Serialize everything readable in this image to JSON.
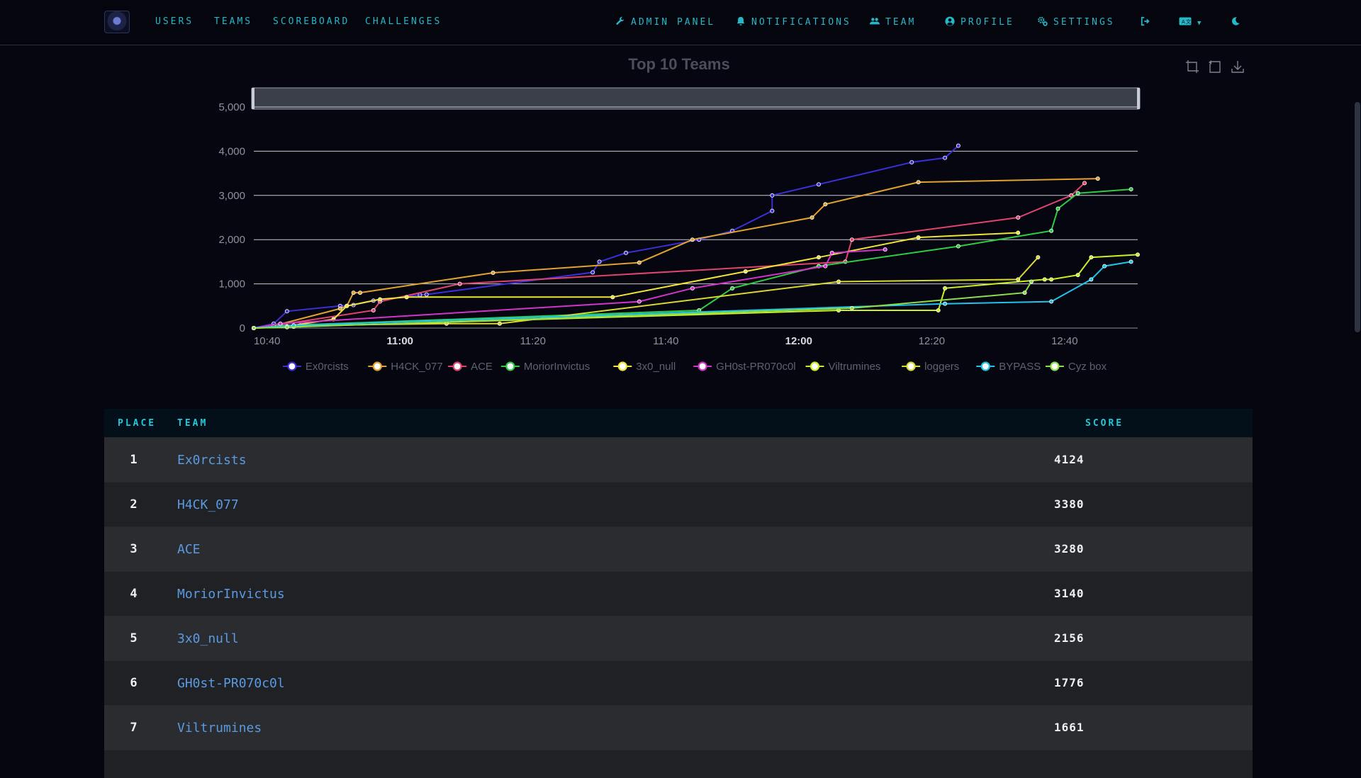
{
  "nav": {
    "left": [
      {
        "label": "USERS"
      },
      {
        "label": "TEAMS"
      },
      {
        "label": "SCOREBOARD"
      },
      {
        "label": "CHALLENGES"
      }
    ],
    "right": [
      {
        "label": "ADMIN PANEL",
        "icon": "wrench-icon"
      },
      {
        "label": "NOTIFICATIONS",
        "icon": "bell-icon"
      },
      {
        "label": "TEAM",
        "icon": "users-icon"
      },
      {
        "label": "PROFILE",
        "icon": "user-circle-icon"
      },
      {
        "label": "SETTINGS",
        "icon": "cogs-icon"
      }
    ],
    "logout_icon": "logout-icon",
    "language_icon": "language-icon",
    "theme_icon": "moon-icon"
  },
  "chart_data": {
    "type": "line",
    "title": "Top 10 Teams",
    "x_ticks": [
      "10:40",
      "11:00",
      "11:20",
      "11:40",
      "12:00",
      "12:20",
      "12:40"
    ],
    "x_major_ticks": [
      "11:00",
      "12:00"
    ],
    "y_ticks": [
      0,
      1000,
      2000,
      3000,
      4000,
      5000
    ],
    "y_tick_labels": [
      "0",
      "1,000",
      "2,000",
      "3,000",
      "4,000",
      "5,000"
    ],
    "xlim": [
      "10:38",
      "12:51"
    ],
    "ylim": [
      0,
      5000
    ],
    "grid": true,
    "legend_position": "bottom",
    "series": [
      {
        "name": "Ex0rcists",
        "color": "#3b30d8",
        "points": [
          [
            "10:38",
            0
          ],
          [
            "10:41",
            100
          ],
          [
            "10:43",
            380
          ],
          [
            "10:51",
            500
          ],
          [
            "10:53",
            520
          ],
          [
            "10:56",
            620
          ],
          [
            "11:03",
            750
          ],
          [
            "11:04",
            760
          ],
          [
            "11:29",
            1260
          ],
          [
            "11:30",
            1500
          ],
          [
            "11:34",
            1700
          ],
          [
            "11:45",
            2000
          ],
          [
            "11:50",
            2200
          ],
          [
            "11:56",
            2650
          ],
          [
            "11:56",
            3000
          ],
          [
            "12:03",
            3250
          ],
          [
            "12:17",
            3750
          ],
          [
            "12:22",
            3850
          ],
          [
            "12:24",
            4124
          ]
        ]
      },
      {
        "name": "H4CK_077",
        "color": "#e1a32f",
        "points": [
          [
            "10:38",
            0
          ],
          [
            "10:41",
            50
          ],
          [
            "10:51",
            440
          ],
          [
            "10:52",
            500
          ],
          [
            "10:53",
            800
          ],
          [
            "10:54",
            800
          ],
          [
            "11:14",
            1250
          ],
          [
            "11:36",
            1480
          ],
          [
            "11:44",
            2000
          ],
          [
            "12:02",
            2500
          ],
          [
            "12:04",
            2800
          ],
          [
            "12:18",
            3300
          ],
          [
            "12:45",
            3380
          ]
        ]
      },
      {
        "name": "ACE",
        "color": "#e0446e",
        "points": [
          [
            "10:38",
            0
          ],
          [
            "10:42",
            80
          ],
          [
            "10:56",
            400
          ],
          [
            "10:57",
            600
          ],
          [
            "11:09",
            1000
          ],
          [
            "12:07",
            1500
          ],
          [
            "12:08",
            2000
          ],
          [
            "12:33",
            2500
          ],
          [
            "12:41",
            3000
          ],
          [
            "12:43",
            3280
          ]
        ]
      },
      {
        "name": "MoriorInvictus",
        "color": "#2ecb43",
        "points": [
          [
            "10:38",
            0
          ],
          [
            "10:41",
            50
          ],
          [
            "11:45",
            400
          ],
          [
            "11:50",
            900
          ],
          [
            "12:03",
            1400
          ],
          [
            "12:24",
            1850
          ],
          [
            "12:38",
            2200
          ],
          [
            "12:39",
            2700
          ],
          [
            "12:42",
            3050
          ],
          [
            "12:50",
            3140
          ]
        ]
      },
      {
        "name": "3x0_null",
        "color": "#f1e436",
        "points": [
          [
            "10:38",
            0
          ],
          [
            "10:43",
            40
          ],
          [
            "10:50",
            200
          ],
          [
            "10:52",
            500
          ],
          [
            "10:57",
            650
          ],
          [
            "11:01",
            700
          ],
          [
            "11:32",
            700
          ],
          [
            "11:52",
            1280
          ],
          [
            "12:03",
            1600
          ],
          [
            "12:18",
            2050
          ],
          [
            "12:33",
            2156
          ]
        ]
      },
      {
        "name": "GH0st-PR070c0l",
        "color": "#d233c8",
        "points": [
          [
            "10:38",
            0
          ],
          [
            "10:42",
            100
          ],
          [
            "11:36",
            600
          ],
          [
            "11:44",
            900
          ],
          [
            "12:04",
            1400
          ],
          [
            "12:05",
            1700
          ],
          [
            "12:13",
            1776
          ]
        ]
      },
      {
        "name": "Viltrumines",
        "color": "#c7f025",
        "points": [
          [
            "10:38",
            0
          ],
          [
            "10:44",
            30
          ],
          [
            "12:06",
            400
          ],
          [
            "12:21",
            400
          ],
          [
            "12:22",
            900
          ],
          [
            "12:37",
            1100
          ],
          [
            "12:38",
            1100
          ],
          [
            "12:42",
            1200
          ],
          [
            "12:44",
            1600
          ],
          [
            "12:51",
            1661
          ]
        ]
      },
      {
        "name": "loggers",
        "color": "#d8d833",
        "points": [
          [
            "10:38",
            0
          ],
          [
            "10:45",
            60
          ],
          [
            "11:07",
            100
          ],
          [
            "11:15",
            100
          ],
          [
            "12:06",
            1050
          ],
          [
            "12:33",
            1100
          ],
          [
            "12:36",
            1600
          ]
        ]
      },
      {
        "name": "BYPASS",
        "color": "#22c3e8",
        "points": [
          [
            "10:38",
            0
          ],
          [
            "10:44",
            60
          ],
          [
            "12:22",
            550
          ],
          [
            "12:38",
            600
          ],
          [
            "12:44",
            1100
          ],
          [
            "12:46",
            1400
          ],
          [
            "12:50",
            1500
          ]
        ]
      },
      {
        "name": "Cyz box",
        "color": "#8be04a",
        "points": [
          [
            "10:38",
            0
          ],
          [
            "10:43",
            20
          ],
          [
            "12:08",
            450
          ],
          [
            "12:34",
            800
          ],
          [
            "12:35",
            1050
          ]
        ]
      }
    ]
  },
  "chart_toolbox": {
    "zoom_icon": "zoom-icon",
    "restore_icon": "restore-icon",
    "download_icon": "download-icon"
  },
  "table": {
    "headers": {
      "place": "PLACE",
      "team": "TEAM",
      "score": "SCORE"
    },
    "rows": [
      {
        "place": "1",
        "team": "Ex0rcists",
        "score": "4124"
      },
      {
        "place": "2",
        "team": "H4CK_077",
        "score": "3380"
      },
      {
        "place": "3",
        "team": "ACE",
        "score": "3280"
      },
      {
        "place": "4",
        "team": "MoriorInvictus",
        "score": "3140"
      },
      {
        "place": "5",
        "team": "3x0_null",
        "score": "2156"
      },
      {
        "place": "6",
        "team": "GH0st-PR070c0l",
        "score": "1776"
      },
      {
        "place": "7",
        "team": "Viltrumines",
        "score": "1661"
      }
    ]
  }
}
